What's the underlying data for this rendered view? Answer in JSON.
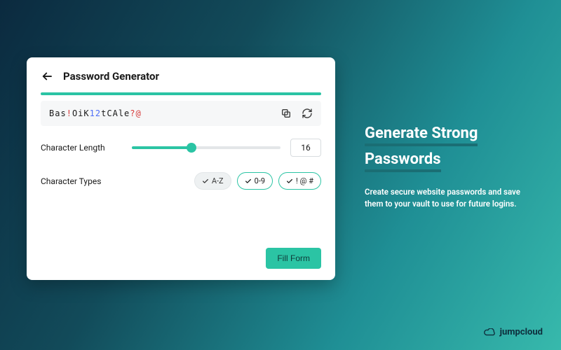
{
  "accent": "#2bc4a4",
  "card": {
    "title": "Password Generator",
    "password": "Bas!OiK12tCAle?@",
    "length_label": "Character Length",
    "length_value": "16",
    "types_label": "Character Types",
    "chips": [
      {
        "label": "A-Z",
        "on": false
      },
      {
        "label": "0-9",
        "on": true
      },
      {
        "label": "! @ #",
        "on": true
      }
    ],
    "fill_button": "Fill Form"
  },
  "promo": {
    "title_line1": "Generate Strong",
    "title_line2": "Passwords",
    "subtitle": "Create secure website passwords and save them to your vault to use for future logins."
  },
  "brand": "jumpcloud"
}
